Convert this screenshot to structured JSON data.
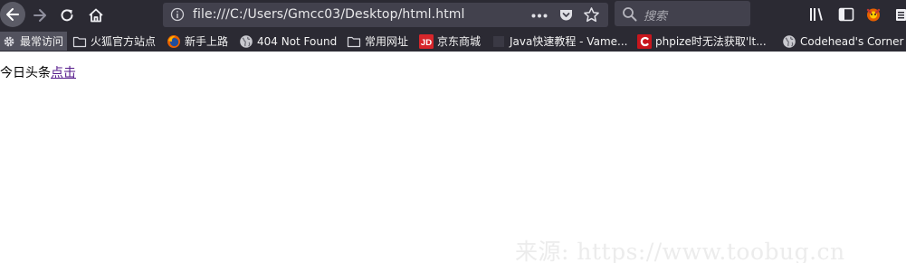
{
  "navigation": {
    "back_icon": "arrow-left-icon",
    "forward_icon": "arrow-right-icon",
    "reload_icon": "reload-icon",
    "home_icon": "home-icon"
  },
  "urlbar": {
    "url": "file:///C:/Users/Gmcc03/Desktop/html.html",
    "info_icon": "info-icon",
    "actions_icon": "ellipsis-icon",
    "pocket_icon": "pocket-icon",
    "bookmark_icon": "star-icon"
  },
  "search": {
    "placeholder": "搜索",
    "icon": "search-icon"
  },
  "toolbar": {
    "library_icon": "library-icon",
    "sidebar_icon": "sidebar-icon",
    "account_icon": "avatar-icon",
    "menu_icon": "menu-icon"
  },
  "bookmarks": [
    {
      "label": "最常访问",
      "icon": "gear-icon"
    },
    {
      "label": "火狐官方站点",
      "icon": "folder-icon"
    },
    {
      "label": "新手上路",
      "icon": "firefox-icon"
    },
    {
      "label": "404 Not Found",
      "icon": "globe-icon"
    },
    {
      "label": "常用网址",
      "icon": "folder-icon"
    },
    {
      "label": "京东商城",
      "icon": "jd-icon"
    },
    {
      "label": "Java快速教程 - Vame...",
      "icon": "page-icon"
    },
    {
      "label": "phpize时无法获取'lt...",
      "icon": "red-c-icon"
    },
    {
      "label": "Codehead's Corner",
      "icon": "globe-icon"
    }
  ],
  "page": {
    "text": "今日头条",
    "link_text": "点击"
  },
  "watermark": "来源: https://www.toobug.cn",
  "colors": {
    "chrome_bg": "#2b2a33",
    "field_bg": "#42414d",
    "visited_link": "#551a8b"
  }
}
